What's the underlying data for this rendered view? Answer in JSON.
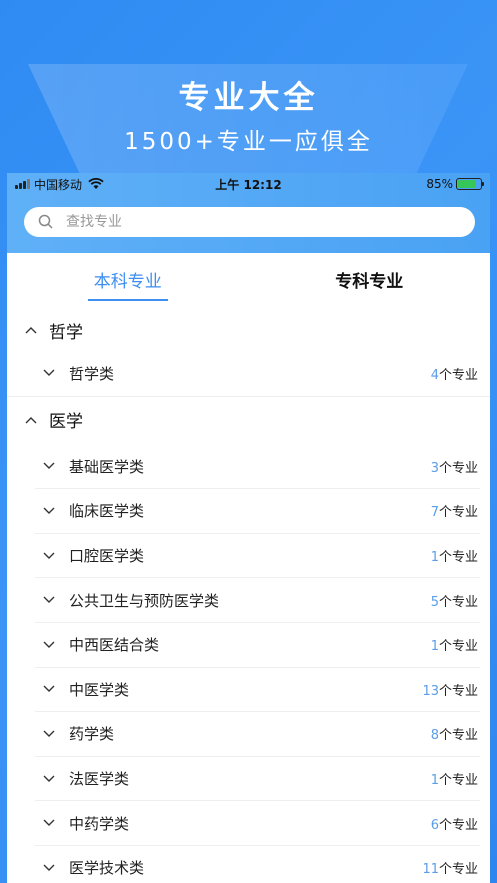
{
  "promo": {
    "title": "专业大全",
    "subtitle": "1500+专业一应俱全"
  },
  "status_bar": {
    "carrier": "中国移动",
    "time": "上午 12:12",
    "battery": "85%"
  },
  "search": {
    "placeholder": "查找专业"
  },
  "tabs": [
    {
      "label": "本科专业",
      "active": true
    },
    {
      "label": "专科专业",
      "active": false
    }
  ],
  "unit_label": "个专业",
  "groups": [
    {
      "name": "哲学",
      "items": [
        {
          "name": "哲学类",
          "count": "4"
        }
      ]
    },
    {
      "name": "医学",
      "items": [
        {
          "name": "基础医学类",
          "count": "3"
        },
        {
          "name": "临床医学类",
          "count": "7"
        },
        {
          "name": "口腔医学类",
          "count": "1"
        },
        {
          "name": "公共卫生与预防医学类",
          "count": "5"
        },
        {
          "name": "中西医结合类",
          "count": "1"
        },
        {
          "name": "中医学类",
          "count": "13"
        },
        {
          "name": "药学类",
          "count": "8"
        },
        {
          "name": "法医学类",
          "count": "1"
        },
        {
          "name": "中药学类",
          "count": "6"
        },
        {
          "name": "医学技术类",
          "count": "11"
        }
      ]
    }
  ],
  "colors": {
    "accent": "#3d8ef0",
    "count_number": "#5a9de8",
    "background": "#2f8bf2"
  }
}
